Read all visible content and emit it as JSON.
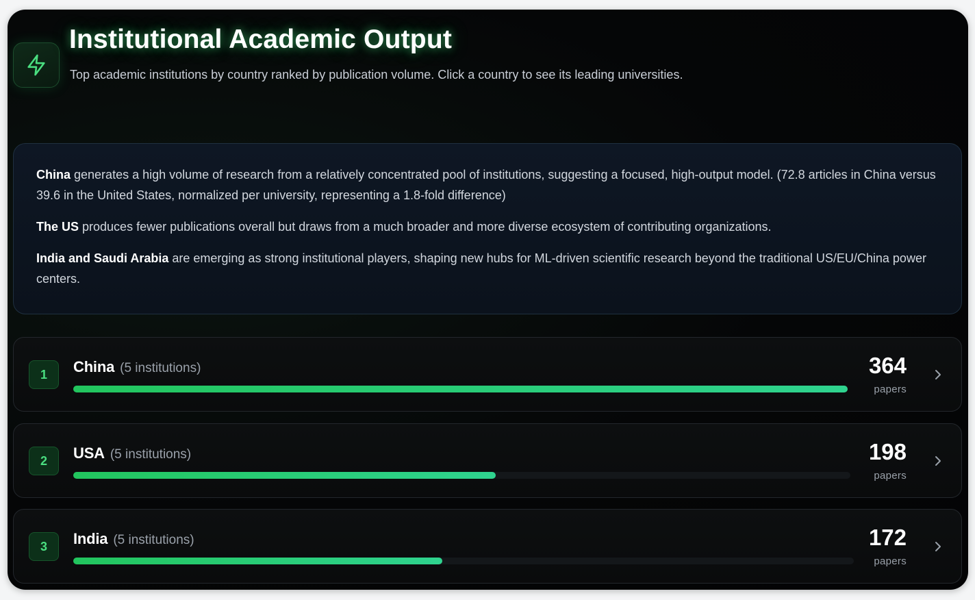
{
  "header": {
    "icon": "lightning-icon",
    "title": "Institutional Academic Output",
    "subtitle": "Top academic institutions by country ranked by publication volume. Click a country to see its leading universities."
  },
  "insights": [
    {
      "bold": "China",
      "text": " generates a high volume of research from a relatively concentrated pool of institutions, suggesting a focused, high-output model. (72.8 articles in China versus 39.6 in the United States, normalized per university, representing a 1.8-fold difference)"
    },
    {
      "bold": "The US",
      "text": " produces fewer publications overall but draws from a much broader and more diverse ecosystem of contributing organizations."
    },
    {
      "bold": "India and Saudi Arabia",
      "text": " are emerging as strong institutional players, shaping new hubs for ML-driven scientific research beyond the traditional US/EU/China power centers."
    }
  ],
  "countries": [
    {
      "rank": "1",
      "name": "China",
      "institutions": "(5 institutions)",
      "papers": "364",
      "unit": "papers",
      "bar_fraction": 1.0
    },
    {
      "rank": "2",
      "name": "USA",
      "institutions": "(5 institutions)",
      "papers": "198",
      "unit": "papers",
      "bar_fraction": 0.544
    },
    {
      "rank": "3",
      "name": "India",
      "institutions": "(5 institutions)",
      "papers": "172",
      "unit": "papers",
      "bar_fraction": 0.473
    }
  ],
  "colors": {
    "accent": "#22c55e",
    "accent_end": "#2fd38f",
    "background": "#050607"
  }
}
